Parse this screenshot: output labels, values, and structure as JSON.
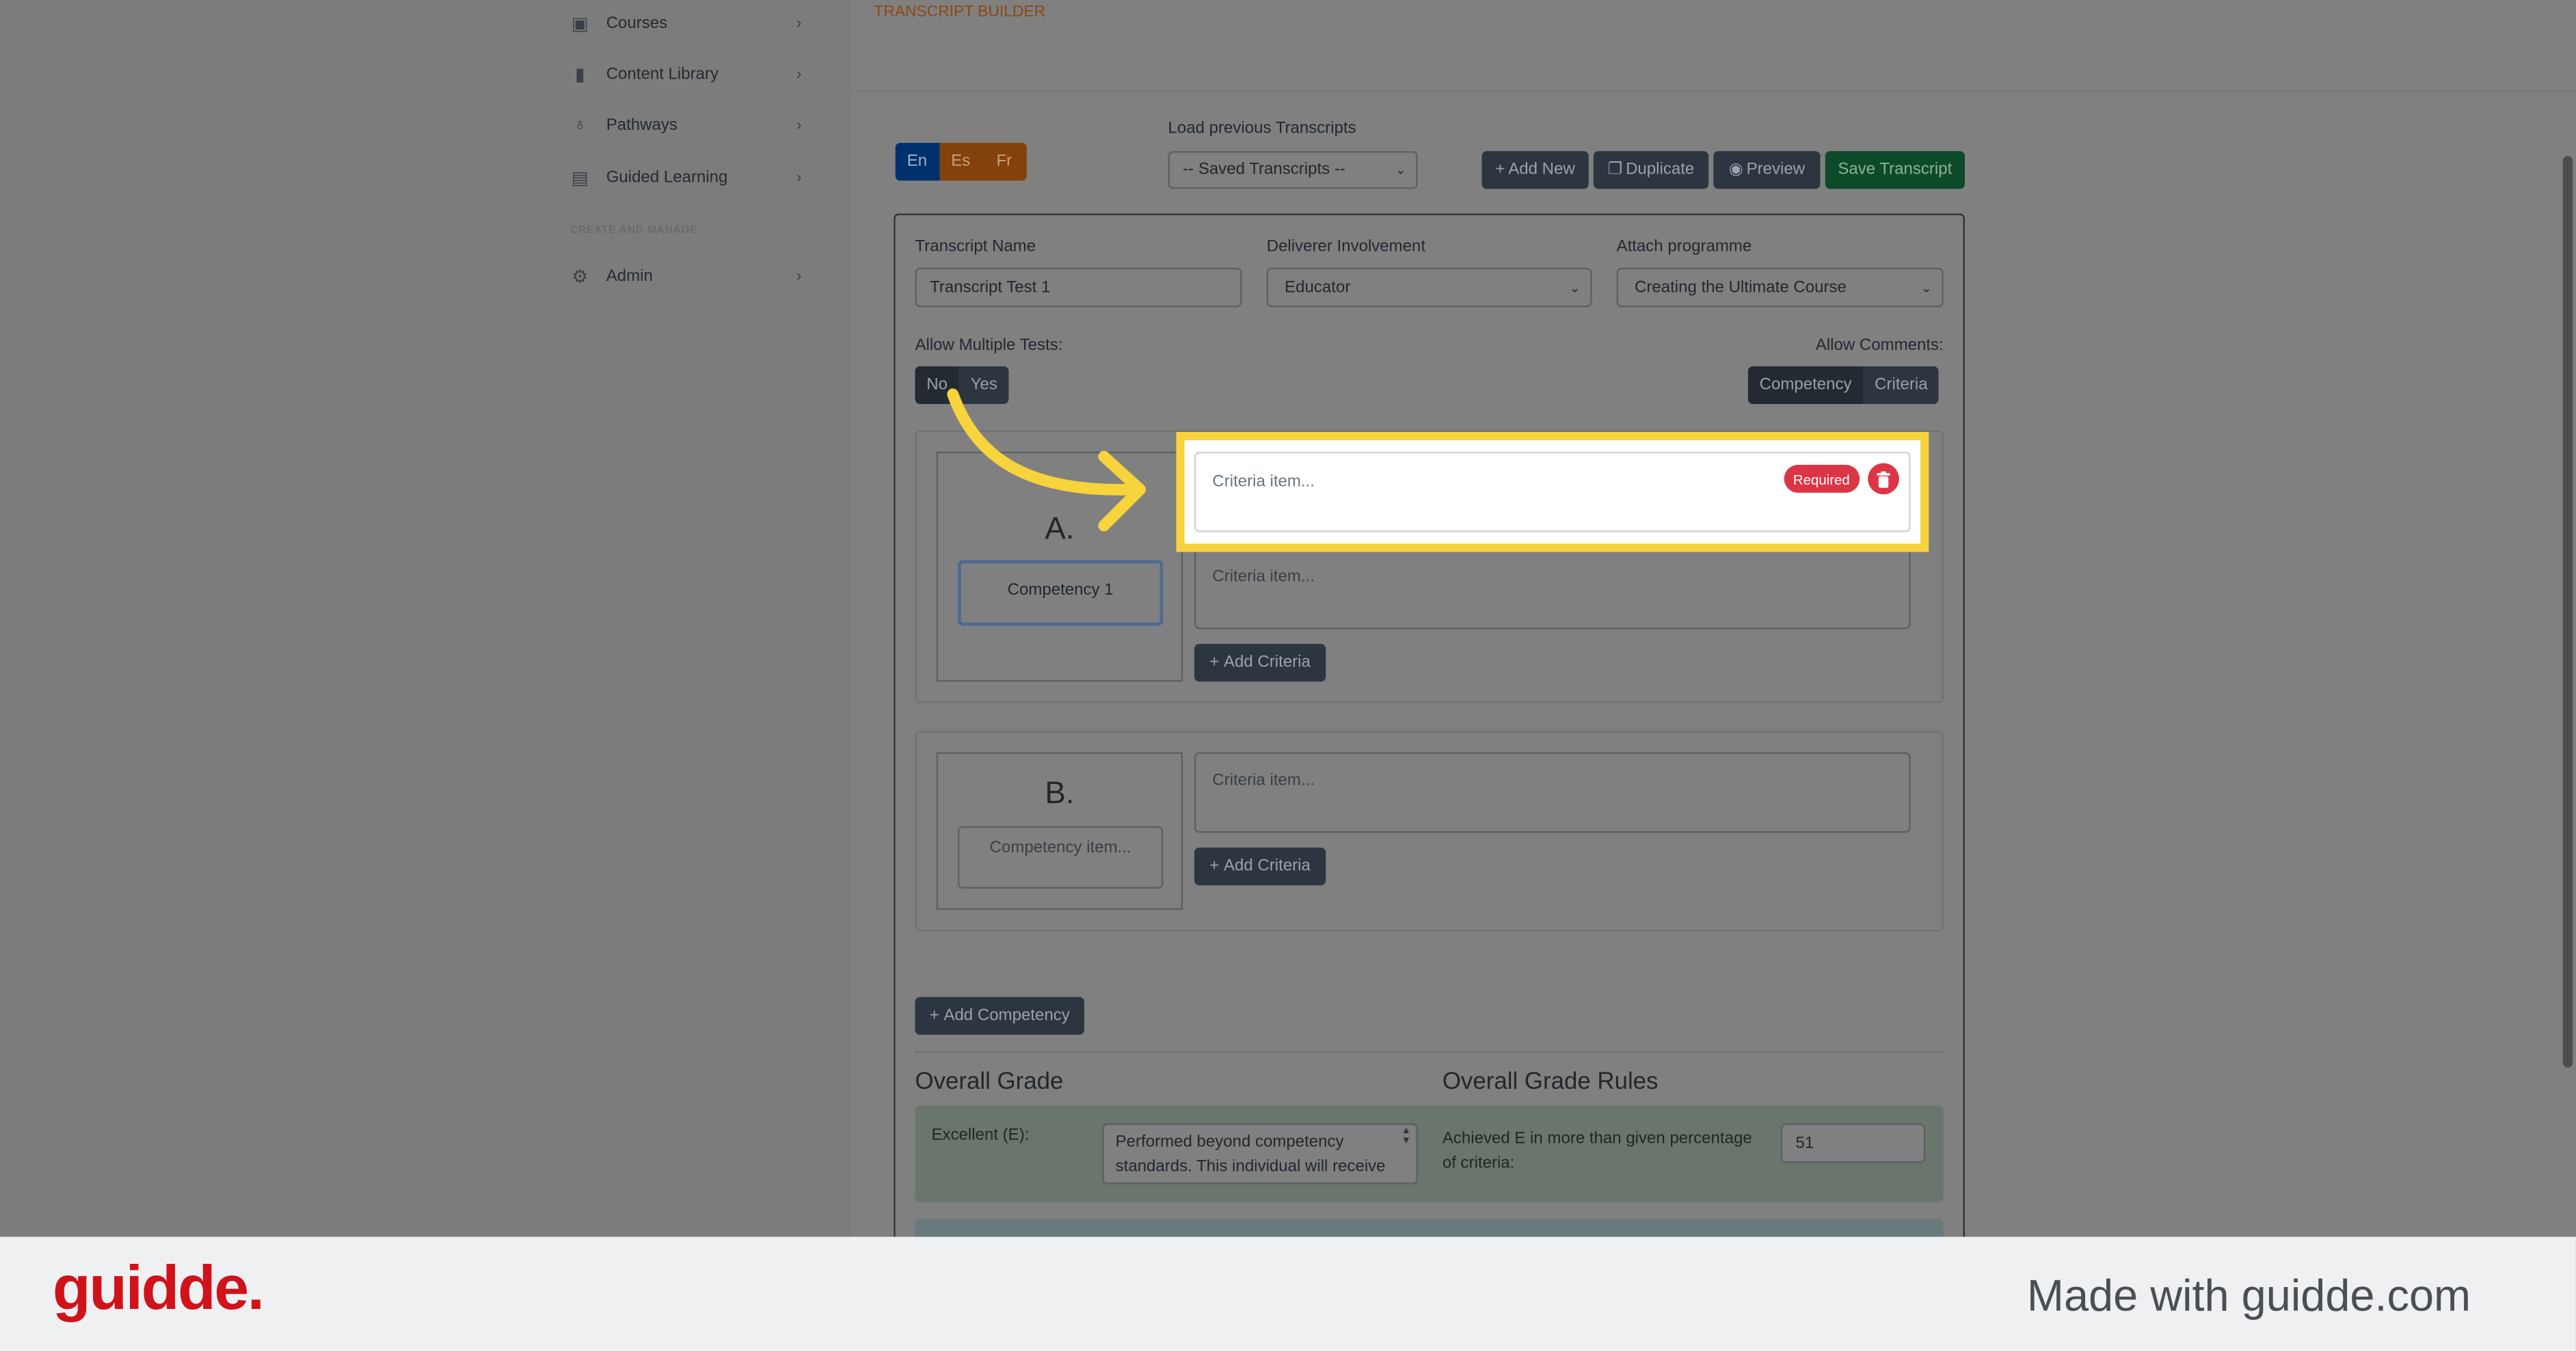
{
  "sidebar": {
    "items": [
      {
        "label": "Courses",
        "icon": "courses-icon"
      },
      {
        "label": "Content Library",
        "icon": "book-icon"
      },
      {
        "label": "Pathways",
        "icon": "award-icon"
      },
      {
        "label": "Guided Learning",
        "icon": "clipboard-icon"
      }
    ],
    "section_heading": "CREATE AND MANAGE",
    "admin": {
      "label": "Admin",
      "icon": "gear-icon"
    }
  },
  "page": {
    "title": "TRANSCRIPT BUILDER"
  },
  "languages": [
    "En",
    "Es",
    "Fr"
  ],
  "load_previous": {
    "label": "Load previous Transcripts",
    "value": "-- Saved Transcripts --"
  },
  "toolbar": {
    "add_new": "Add New",
    "duplicate": "Duplicate",
    "preview": "Preview",
    "save": "Save Transcript"
  },
  "form": {
    "name_label": "Transcript Name",
    "name_value": "Transcript Test 1",
    "deliverer_label": "Deliverer Involvement",
    "deliverer_value": "Educator",
    "programme_label": "Attach programme",
    "programme_value": "Creating the Ultimate Course",
    "multiple_label": "Allow Multiple Tests:",
    "multiple_options": [
      "No",
      "Yes"
    ],
    "comments_label": "Allow Comments:",
    "comments_options": [
      "Competency",
      "Criteria"
    ]
  },
  "competencies": [
    {
      "letter": "A.",
      "name": "Competency 1",
      "criteria": [
        "Criteria item...",
        "Criteria item..."
      ],
      "add_criteria": "Add Criteria"
    },
    {
      "letter": "B.",
      "name_placeholder": "Competency item...",
      "criteria": [
        "Criteria item..."
      ],
      "add_criteria": "Add Criteria"
    }
  ],
  "highlight": {
    "required": "Required",
    "color": "#f7d33c"
  },
  "add_competency": "Add Competency",
  "grade": {
    "title": "Overall Grade",
    "rules_title": "Overall Grade Rules",
    "excellent_label": "Excellent (E):",
    "excellent_text": "Performed beyond competency standards. This individual will receive",
    "rule_text": "Achieved E in more than given percentage of criteria:",
    "rule_value": "51"
  },
  "footer": {
    "logo": "guidde.",
    "made_with": "Made with guidde.com"
  }
}
